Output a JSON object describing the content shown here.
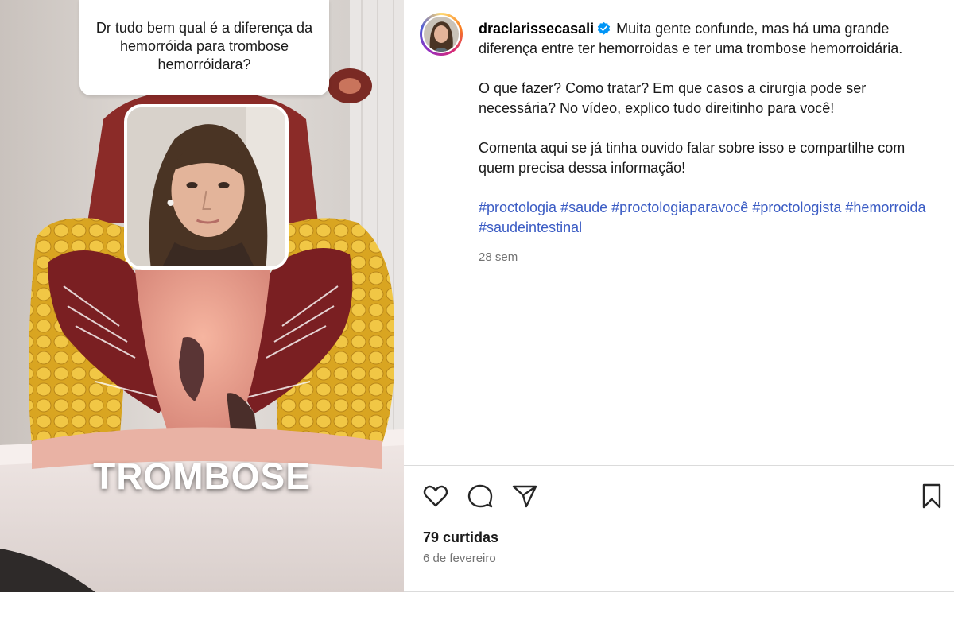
{
  "media": {
    "question": "Dr tudo bem qual é a diferença da hemorróida para trombose hemorróidara?",
    "overlay_text": "TROMBOSE"
  },
  "post": {
    "username": "draclarissecasali",
    "verified": true,
    "caption_intro": "Muita gente confunde, mas há uma grande diferença entre ter hemorroidas e ter uma trombose hemorroidária.",
    "caption_para2": "O que fazer? Como tratar? Em que casos a cirurgia pode ser necessária? No vídeo, explico tudo direitinho para você!",
    "caption_para3": "Comenta aqui se já tinha ouvido falar sobre isso e compartilhe com quem precisa dessa informação!",
    "hashtags": [
      "#proctologia",
      "#saude",
      "#proctologiaparavocê",
      "#proctologista",
      "#hemorroida",
      "#saudeintestinal"
    ],
    "time_ago": "28 sem",
    "likes": "79 curtidas",
    "date": "6 de fevereiro"
  },
  "icons": {
    "like": "heart-icon",
    "comment": "comment-icon",
    "share": "paper-plane-icon",
    "save": "bookmark-icon",
    "verified": "verified-badge-icon"
  },
  "colors": {
    "hashtag": "#3b5cc4",
    "verified": "#0095f6",
    "muted": "#737373"
  }
}
